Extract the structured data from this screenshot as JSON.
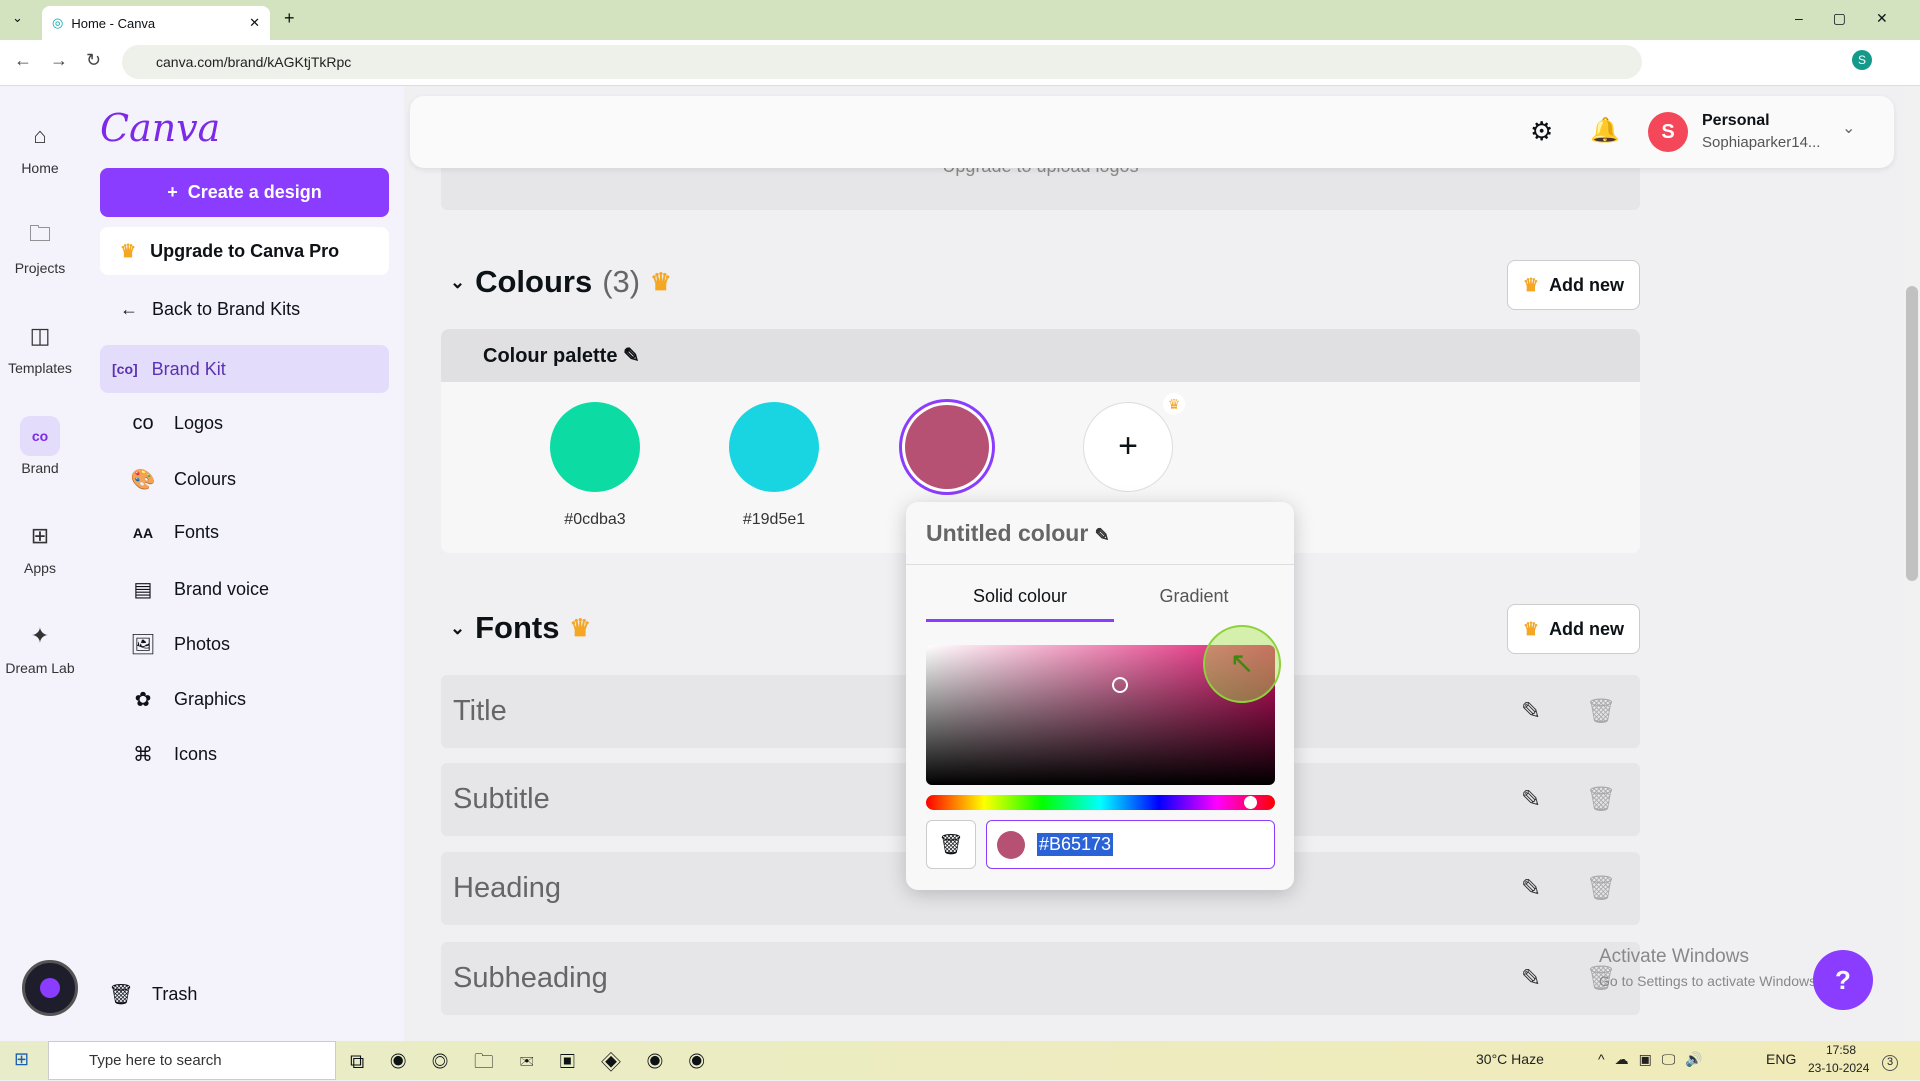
{
  "browser": {
    "tab_title": "Home - Canva",
    "url": "canva.com/brand/kAGKtjTkRpc",
    "profile_initial": "S"
  },
  "rail": [
    {
      "label": "Home",
      "icon": "home-icon"
    },
    {
      "label": "Projects",
      "icon": "folder-icon"
    },
    {
      "label": "Templates",
      "icon": "templates-icon"
    },
    {
      "label": "Brand",
      "icon": "brand-icon"
    },
    {
      "label": "Apps",
      "icon": "apps-icon"
    },
    {
      "label": "Dream Lab",
      "icon": "dream-lab-icon"
    }
  ],
  "sidebar": {
    "logo": "Canva",
    "create": "Create a design",
    "upgrade": "Upgrade to Canva Pro",
    "back": "Back to Brand Kits",
    "brand_kit": "Brand Kit",
    "items": [
      {
        "label": "Logos",
        "icon": "co"
      },
      {
        "label": "Colours",
        "icon": "🎨"
      },
      {
        "label": "Fonts",
        "icon": "AA"
      },
      {
        "label": "Brand voice",
        "icon": "▤"
      },
      {
        "label": "Photos",
        "icon": "🖼"
      },
      {
        "label": "Graphics",
        "icon": "✿"
      },
      {
        "label": "Icons",
        "icon": "⌘"
      }
    ],
    "trash": "Trash"
  },
  "header": {
    "account_type": "Personal",
    "account_name": "Sophiaparker14...",
    "avatar": "S",
    "behind_text": "Upgrade to upload logos"
  },
  "colours": {
    "title": "Colours",
    "count": "(3)",
    "add_new": "Add new",
    "palette_title": "Colour palette",
    "swatches": [
      {
        "hex": "#0cdba3",
        "label": "#0cdba3"
      },
      {
        "hex": "#19d5e1",
        "label": "#19d5e1"
      },
      {
        "hex": "#B65173",
        "label": ""
      }
    ]
  },
  "fonts": {
    "title": "Fonts",
    "add_new": "Add new",
    "rows": [
      "Title",
      "Subtitle",
      "Heading",
      "Subheading"
    ]
  },
  "popup": {
    "title": "Untitled colour",
    "tabs": [
      "Solid colour",
      "Gradient"
    ],
    "active_tab": "Solid colour",
    "hex_value": "#B65173"
  },
  "accent": "#8b3dff",
  "watermark": {
    "line1": "Activate Windows",
    "line2": "Go to Settings to activate Windows."
  },
  "help": "?",
  "taskbar": {
    "search_placeholder": "Type here to search",
    "weather": "30°C  Haze",
    "lang": "ENG",
    "time": "17:58",
    "date": "23-10-2024",
    "notif_count": "3"
  }
}
